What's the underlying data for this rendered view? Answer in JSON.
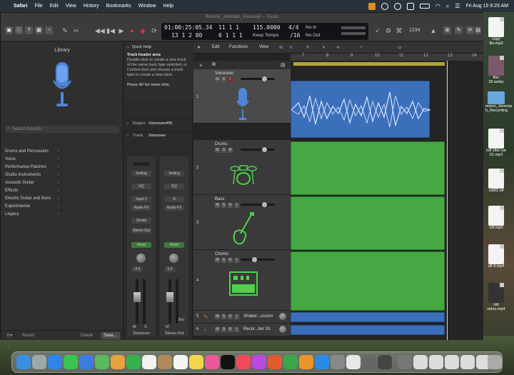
{
  "menubar": {
    "app": "Safari",
    "items": [
      "File",
      "Edit",
      "View",
      "History",
      "Bookmarks",
      "Window",
      "Help"
    ],
    "datetime": "Fri Aug 15  9:29 AM"
  },
  "window": {
    "title": "Remote_Jeremiah_Voiceover – Tracks"
  },
  "lcd": {
    "time": "01:00:25:05.34",
    "bars": "13  1  2  80",
    "beat1": "11  1  1",
    "beat2": "6  1  1  1",
    "tempo": "115.0000",
    "tempo_label": "Keep Tempo",
    "sig": "4/4",
    "div": "/16",
    "in": "No In",
    "out": "No Out",
    "zoom": "1234"
  },
  "library": {
    "title": "Library",
    "search_placeholder": "Search Sounds",
    "categories": [
      "Drums and Percussion",
      "Voice",
      "Performance Patches",
      "Studio Instruments",
      "Acoustic Guitar",
      "Effects",
      "Electric Guitar and Bass",
      "Experimental",
      "Legacy"
    ],
    "revert": "Revert",
    "delete": "Delete",
    "save": "Save..."
  },
  "inspector": {
    "quick_help": "Quick Help",
    "qh_title": "Track header area",
    "qh_text": "Double-click to create a new track of the same track type selected, or Control-click and choose a track type to create a new track.",
    "qh_more": "Press ⌘/ for more info.",
    "region_label": "Region:",
    "region_value": "Voiceover#05",
    "track_label": "Track:",
    "track_value": "Voiceover",
    "strip1": {
      "setting": "Setting",
      "eq": "EQ",
      "input": "Input 1",
      "fx": "Audio FX",
      "sends": "Sends",
      "out": "Stereo Out",
      "mode": "Read",
      "vol": "-3.0",
      "name": "Voiceover"
    },
    "strip2": {
      "setting": "Setting",
      "eq": "EQ",
      "fx": "Audio FX",
      "mode": "Read",
      "vol": "0.0",
      "bnc": "Bnc",
      "name": "Stereo Out"
    }
  },
  "tracks": {
    "toolbar": {
      "edit": "Edit",
      "functions": "Functions",
      "view": "View"
    },
    "ruler": [
      "7",
      "8",
      "9",
      "10",
      "11",
      "12",
      "13",
      "14"
    ],
    "list": [
      {
        "num": "1",
        "name": "Voiceover"
      },
      {
        "num": "2",
        "name": "Drums"
      },
      {
        "num": "3",
        "name": "Bass"
      },
      {
        "num": "4",
        "name": "Chords"
      },
      {
        "num": "5",
        "name": "Shaker...ussion"
      },
      {
        "num": "6",
        "name": "Recor...iter 03"
      }
    ]
  },
  "desktop": [
    {
      "name": "copy file.mp3"
    },
    {
      "name": "flier 02.webp"
    },
    {
      "name": "mison_Jeremia h_Recording"
    },
    {
      "name": "lofi vibe cat 01.mp3"
    },
    {
      "name": "cat02.aif"
    },
    {
      "name": "lofi.mp3"
    },
    {
      "name": "ofi 4.mp4"
    },
    {
      "name": "lofi video.mp4"
    }
  ],
  "colors": {
    "midi": "#45a843",
    "audio": "#3b6fba",
    "cycle": "#b5a437"
  }
}
